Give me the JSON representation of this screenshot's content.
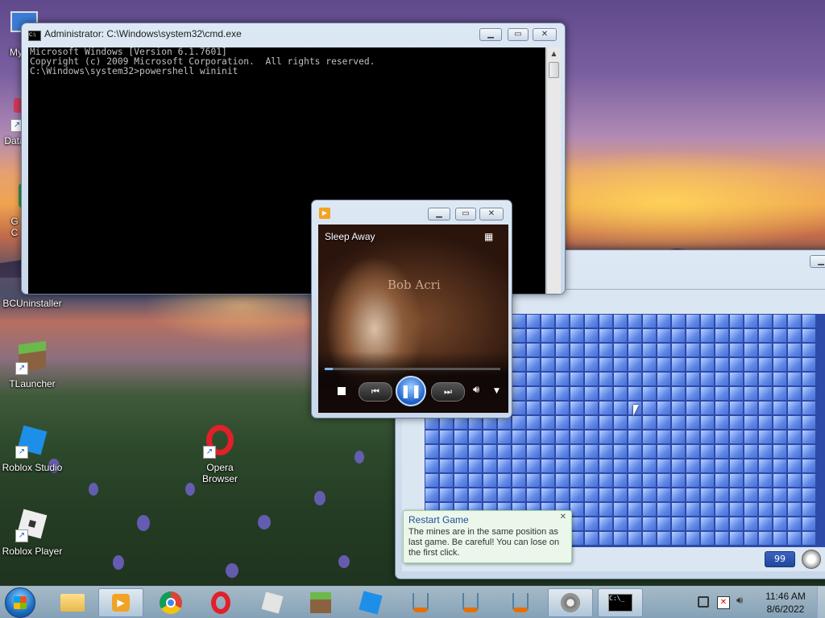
{
  "desktop": {
    "icons": [
      {
        "label": "My C"
      },
      {
        "label": "Data"
      },
      {
        "label": "G\nC"
      },
      {
        "label": "BCUninstaller"
      },
      {
        "label": "TLauncher"
      },
      {
        "label": "Roblox Studio"
      },
      {
        "label": "Opera\nBrowser"
      },
      {
        "label": "Roblox Player"
      }
    ]
  },
  "cmd": {
    "title": "Administrator: C:\\Windows\\system32\\cmd.exe",
    "lines": [
      "Microsoft Windows [Version 6.1.7601]",
      "Copyright (c) 2009 Microsoft Corporation.  All rights reserved.",
      "",
      "C:\\Windows\\system32>powershell wininit"
    ]
  },
  "media_player": {
    "track_title": "Sleep Away",
    "album_art_text": "Bob Acri"
  },
  "minesweeper": {
    "counter": "99",
    "tooltip": {
      "title": "Restart Game",
      "body": "The mines are in the same position as last game. Be careful! You can lose on the first click."
    },
    "cell_color": "#5f87e6"
  },
  "taskbar": {
    "clock_time": "11:46 AM",
    "clock_date": "8/6/2022",
    "items": [
      "start-orb",
      "explorer",
      "media-player",
      "chrome",
      "opera",
      "roblox-studio",
      "minecraft",
      "roblox",
      "java",
      "java",
      "java",
      "settings",
      "cmd"
    ]
  }
}
